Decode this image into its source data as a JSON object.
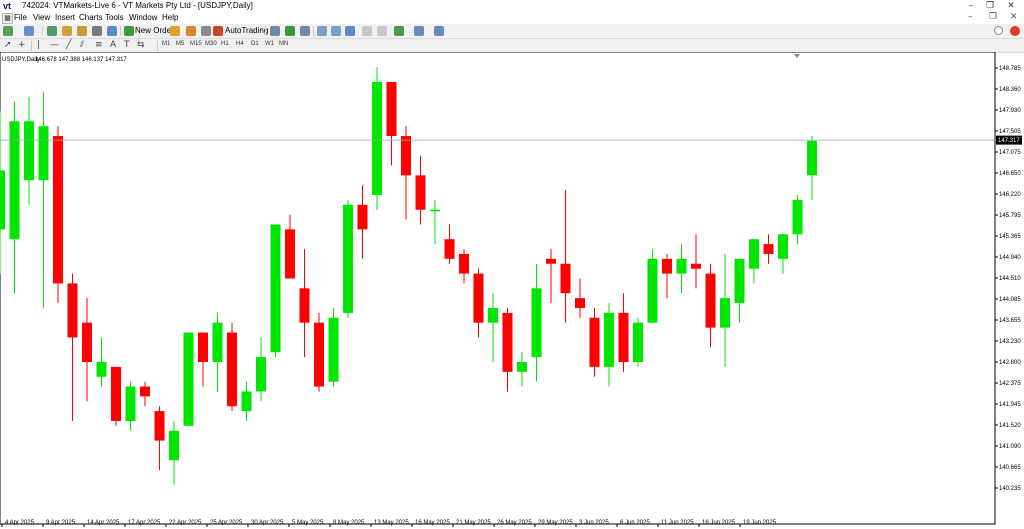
{
  "window": {
    "title": "742024: VTMarkets-Live 6 - VT Markets Pty Ltd - [USDJPY,Daily]",
    "app_icon": "vt"
  },
  "menu": [
    "File",
    "View",
    "Insert",
    "Charts",
    "Tools",
    "Window",
    "Help"
  ],
  "toolbar": {
    "new_order_label": "New Order",
    "autotrading_label": "AutoTrading",
    "timeframes": [
      "M1",
      "M5",
      "M15",
      "M30",
      "H1",
      "H4",
      "D1",
      "W1",
      "MN"
    ]
  },
  "chart_data": {
    "type": "candlestick",
    "symbol_label": "USDJPY,Daily",
    "ohlc_label": "146.678 147.388 146.137 147.317",
    "y_ticks": [
      "148.785",
      "148.360",
      "147.930",
      "147.505",
      "147.075",
      "146.650",
      "146.220",
      "145.795",
      "145.365",
      "144.940",
      "144.510",
      "144.085",
      "143.655",
      "143.230",
      "142.800",
      "142.375",
      "141.945",
      "141.520",
      "141.090",
      "140.665",
      "140.235"
    ],
    "x_ticks": [
      "4 Apr 2025",
      "9 Apr 2025",
      "14 Apr 2025",
      "17 Apr 2025",
      "22 Apr 2025",
      "25 Apr 2025",
      "30 Apr 2025",
      "5 May 2025",
      "8 May 2025",
      "13 May 2025",
      "16 May 2025",
      "21 May 2025",
      "26 May 2025",
      "29 May 2025",
      "3 Jun 2025",
      "6 Jun 2025",
      "11 Jun 2025",
      "16 Jun 2025",
      "19 Jun 2025"
    ],
    "current_price": "147.317",
    "current_price_value": 147.317,
    "up_color": "#00e600",
    "down_color": "#ff0000",
    "candles": [
      {
        "o": 145.5,
        "h": 147.9,
        "l": 144.6,
        "c": 146.7
      },
      {
        "o": 145.3,
        "h": 148.1,
        "l": 144.2,
        "c": 147.7
      },
      {
        "o": 146.5,
        "h": 148.2,
        "l": 146.0,
        "c": 147.7
      },
      {
        "o": 146.5,
        "h": 148.3,
        "l": 143.9,
        "c": 147.6
      },
      {
        "o": 147.4,
        "h": 147.6,
        "l": 144.0,
        "c": 144.4
      },
      {
        "o": 144.4,
        "h": 144.6,
        "l": 141.6,
        "c": 143.3
      },
      {
        "o": 143.6,
        "h": 144.1,
        "l": 142.0,
        "c": 142.8
      },
      {
        "o": 142.5,
        "h": 143.3,
        "l": 142.3,
        "c": 142.8
      },
      {
        "o": 142.7,
        "h": 142.7,
        "l": 141.5,
        "c": 141.6
      },
      {
        "o": 141.6,
        "h": 142.4,
        "l": 141.4,
        "c": 142.3
      },
      {
        "o": 142.3,
        "h": 142.4,
        "l": 141.9,
        "c": 142.1
      },
      {
        "o": 141.8,
        "h": 141.9,
        "l": 140.6,
        "c": 141.2
      },
      {
        "o": 140.8,
        "h": 141.6,
        "l": 140.3,
        "c": 141.4
      },
      {
        "o": 141.5,
        "h": 143.4,
        "l": 141.5,
        "c": 143.4
      },
      {
        "o": 143.4,
        "h": 143.4,
        "l": 142.3,
        "c": 142.8
      },
      {
        "o": 142.8,
        "h": 143.8,
        "l": 142.2,
        "c": 143.6
      },
      {
        "o": 143.4,
        "h": 143.6,
        "l": 141.8,
        "c": 141.9
      },
      {
        "o": 141.8,
        "h": 142.4,
        "l": 141.6,
        "c": 142.2
      },
      {
        "o": 142.2,
        "h": 143.3,
        "l": 142.0,
        "c": 142.9
      },
      {
        "o": 143.0,
        "h": 145.6,
        "l": 142.9,
        "c": 145.6
      },
      {
        "o": 145.5,
        "h": 145.8,
        "l": 144.5,
        "c": 144.5
      },
      {
        "o": 144.3,
        "h": 145.1,
        "l": 142.9,
        "c": 143.6
      },
      {
        "o": 143.6,
        "h": 143.8,
        "l": 142.2,
        "c": 142.3
      },
      {
        "o": 142.4,
        "h": 143.9,
        "l": 142.3,
        "c": 143.7
      },
      {
        "o": 143.8,
        "h": 146.1,
        "l": 143.7,
        "c": 146.0
      },
      {
        "o": 146.0,
        "h": 146.4,
        "l": 144.9,
        "c": 145.5
      },
      {
        "o": 146.2,
        "h": 148.8,
        "l": 145.9,
        "c": 148.5
      },
      {
        "o": 148.5,
        "h": 148.5,
        "l": 146.8,
        "c": 147.4
      },
      {
        "o": 147.4,
        "h": 147.6,
        "l": 145.7,
        "c": 146.6
      },
      {
        "o": 146.6,
        "h": 147.0,
        "l": 145.6,
        "c": 145.9
      },
      {
        "o": 145.9,
        "h": 146.1,
        "l": 145.2,
        "c": 145.9
      },
      {
        "o": 145.3,
        "h": 145.6,
        "l": 144.8,
        "c": 144.9
      },
      {
        "o": 145.0,
        "h": 145.1,
        "l": 144.4,
        "c": 144.6
      },
      {
        "o": 144.6,
        "h": 144.7,
        "l": 143.3,
        "c": 143.6
      },
      {
        "o": 143.6,
        "h": 144.2,
        "l": 142.8,
        "c": 143.9
      },
      {
        "o": 143.8,
        "h": 143.9,
        "l": 142.2,
        "c": 142.6
      },
      {
        "o": 142.6,
        "h": 143.0,
        "l": 142.3,
        "c": 142.8
      },
      {
        "o": 142.9,
        "h": 144.8,
        "l": 142.4,
        "c": 144.3
      },
      {
        "o": 144.9,
        "h": 145.1,
        "l": 144.0,
        "c": 144.8
      },
      {
        "o": 144.8,
        "h": 146.3,
        "l": 143.6,
        "c": 144.2
      },
      {
        "o": 144.1,
        "h": 144.5,
        "l": 143.7,
        "c": 143.9
      },
      {
        "o": 143.7,
        "h": 143.9,
        "l": 142.5,
        "c": 142.7
      },
      {
        "o": 142.7,
        "h": 144.0,
        "l": 142.3,
        "c": 143.8
      },
      {
        "o": 143.8,
        "h": 144.2,
        "l": 142.6,
        "c": 142.8
      },
      {
        "o": 142.8,
        "h": 143.7,
        "l": 142.7,
        "c": 143.6
      },
      {
        "o": 143.6,
        "h": 145.1,
        "l": 143.6,
        "c": 144.9
      },
      {
        "o": 144.9,
        "h": 145.0,
        "l": 144.1,
        "c": 144.6
      },
      {
        "o": 144.6,
        "h": 145.2,
        "l": 144.2,
        "c": 144.9
      },
      {
        "o": 144.8,
        "h": 145.4,
        "l": 144.3,
        "c": 144.7
      },
      {
        "o": 144.6,
        "h": 144.8,
        "l": 143.1,
        "c": 143.5
      },
      {
        "o": 143.5,
        "h": 145.0,
        "l": 142.7,
        "c": 144.1
      },
      {
        "o": 144.0,
        "h": 144.9,
        "l": 143.6,
        "c": 144.9
      },
      {
        "o": 144.7,
        "h": 145.3,
        "l": 144.4,
        "c": 145.3
      },
      {
        "o": 145.2,
        "h": 145.4,
        "l": 144.8,
        "c": 145.0
      },
      {
        "o": 144.9,
        "h": 145.4,
        "l": 144.6,
        "c": 145.4
      },
      {
        "o": 145.4,
        "h": 146.2,
        "l": 145.2,
        "c": 146.1
      },
      {
        "o": 146.6,
        "h": 147.4,
        "l": 146.1,
        "c": 147.3
      }
    ]
  }
}
